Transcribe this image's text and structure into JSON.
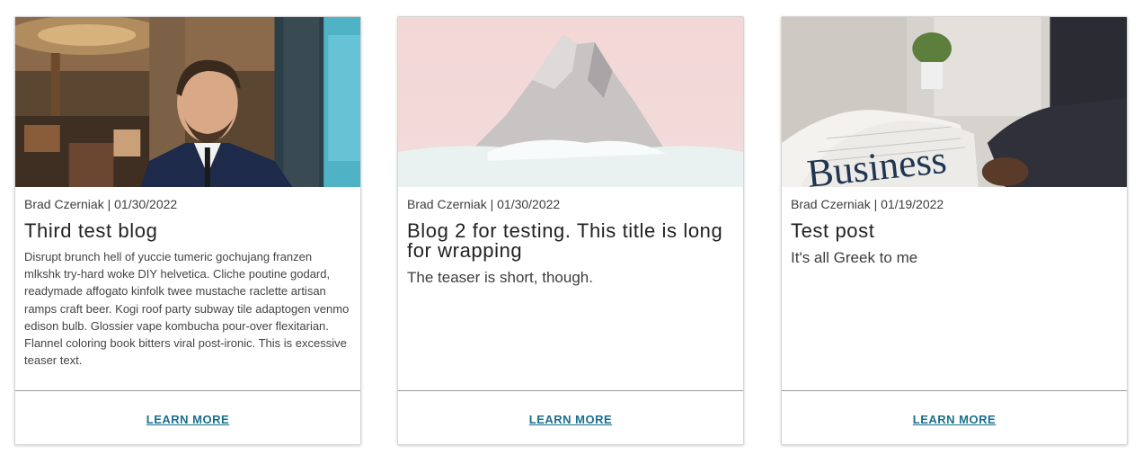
{
  "cards": [
    {
      "byline": "Brad Czerniak | 01/30/2022",
      "title": "Third test blog",
      "teaser": "Disrupt brunch hell of yuccie tumeric gochujang franzen mlkshk try-hard woke DIY helvetica. Cliche poutine godard, readymade affogato kinfolk twee mustache raclette artisan ramps craft beer. Kogi roof party subway tile adaptogen venmo edison bulb. Glossier vape kombucha pour-over flexitarian. Flannel coloring book bitters viral post-ironic. This is excessive teaser text.",
      "link_label": "LEARN MORE"
    },
    {
      "byline": "Brad Czerniak | 01/30/2022",
      "title": "Blog 2 for testing. This title is long for wrapping",
      "teaser": "The teaser is short, though.",
      "link_label": "LEARN MORE"
    },
    {
      "byline": "Brad Czerniak | 01/19/2022",
      "title": "Test post",
      "teaser": "It's all Greek to me",
      "image_text": "Business",
      "link_label": "LEARN MORE"
    }
  ],
  "colors": {
    "link": "#1a6f8e",
    "border": "#d4d4d4",
    "divider": "#9a9a9a"
  }
}
